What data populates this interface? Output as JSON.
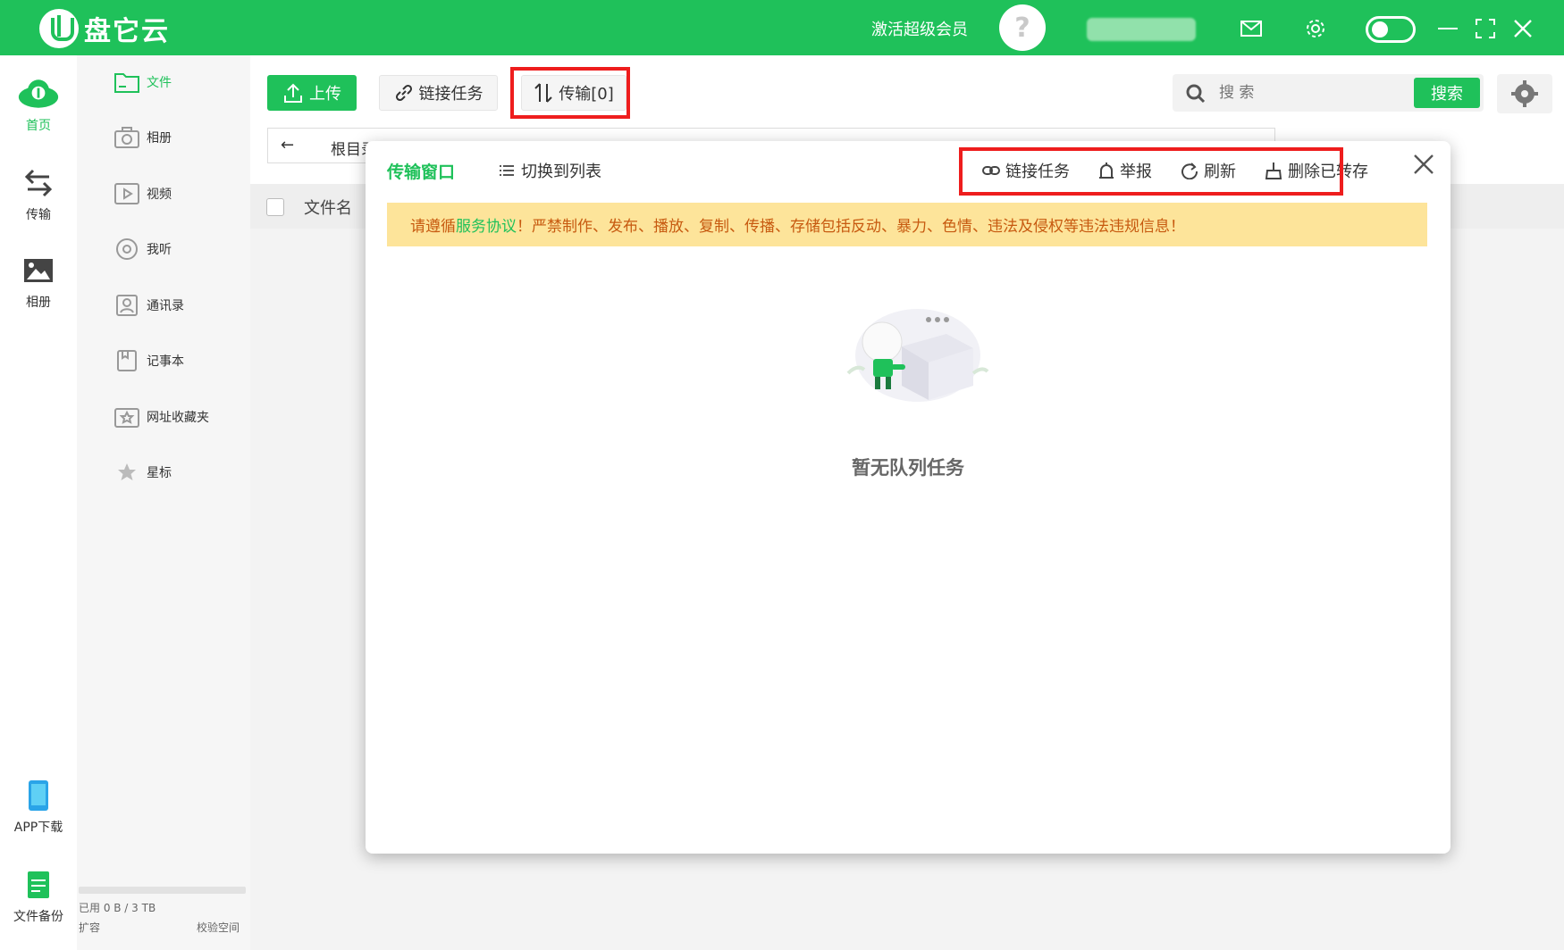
{
  "app": {
    "title": "盘它云",
    "brand_color": "#1fc15a"
  },
  "topbar": {
    "activate_vip": "激活超级会员",
    "icons": [
      "mail-icon",
      "gear-icon",
      "toggle-switch",
      "minimize-icon",
      "fullscreen-icon",
      "close-icon"
    ]
  },
  "rail": {
    "items": [
      {
        "label": "首页",
        "icon": "cloud-home-icon",
        "active": true
      },
      {
        "label": "传输",
        "icon": "transfer-arrows-icon",
        "active": false
      },
      {
        "label": "相册",
        "icon": "photo-icon",
        "active": false
      }
    ],
    "bottom": [
      {
        "label": "APP下载",
        "icon": "phone-icon"
      },
      {
        "label": "文件备份",
        "icon": "document-icon"
      }
    ]
  },
  "sidebar": {
    "items": [
      {
        "label": "文件",
        "icon": "folder-icon",
        "active": true
      },
      {
        "label": "相册",
        "icon": "camera-icon"
      },
      {
        "label": "视频",
        "icon": "video-icon"
      },
      {
        "label": "我听",
        "icon": "music-disc-icon"
      },
      {
        "label": "通讯录",
        "icon": "contacts-icon"
      },
      {
        "label": "记事本",
        "icon": "notebook-icon"
      },
      {
        "label": "网址收藏夹",
        "icon": "bookmark-icon"
      },
      {
        "label": "星标",
        "icon": "star-icon"
      }
    ],
    "storage_used": "已用 0 B / 3 TB",
    "storage_fraction": 0,
    "expand": "扩容",
    "verify": "校验空间"
  },
  "toolbar": {
    "upload": "上传",
    "link_task": "链接任务",
    "transfer": "传输[0]",
    "search_placeholder": "搜 索",
    "search_button": "搜索"
  },
  "path": {
    "root": "根目录"
  },
  "list": {
    "col_filename": "文件名"
  },
  "modal": {
    "title": "传输窗口",
    "switch_list": "切换到列表",
    "tools": [
      "链接任务",
      "举报",
      "刷新",
      "删除已转存"
    ],
    "notice_prefix": "请遵循",
    "notice_link": "服务协议",
    "notice_suffix": "！严禁制作、发布、播放、复制、传播、存储包括反动、暴力、色情、违法及侵权等违法违规信息！",
    "empty_text": "暂无队列任务"
  }
}
